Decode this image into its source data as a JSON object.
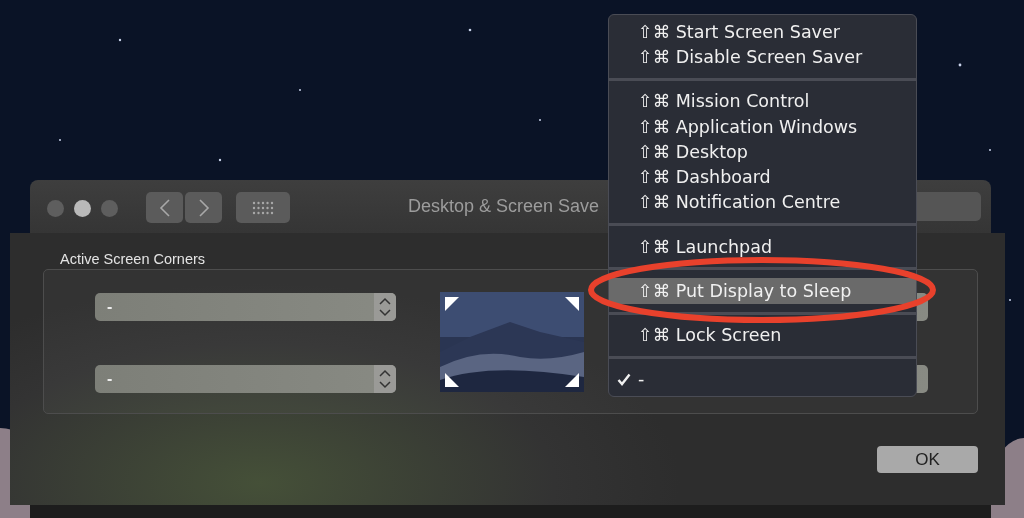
{
  "window": {
    "title": "Desktop & Screen Save"
  },
  "sheet": {
    "heading": "Active Screen Corners",
    "left_corners": [
      {
        "value": "-"
      },
      {
        "value": "-"
      }
    ],
    "ok_button": "OK"
  },
  "menu": {
    "sections": [
      [
        {
          "shortcut": "⇧⌘",
          "label": "Start Screen Saver",
          "selected": false,
          "checked": false
        },
        {
          "shortcut": "⇧⌘",
          "label": "Disable Screen Saver",
          "selected": false,
          "checked": false
        }
      ],
      [
        {
          "shortcut": "⇧⌘",
          "label": "Mission Control",
          "selected": false,
          "checked": false
        },
        {
          "shortcut": "⇧⌘",
          "label": "Application Windows",
          "selected": false,
          "checked": false
        },
        {
          "shortcut": "⇧⌘",
          "label": "Desktop",
          "selected": false,
          "checked": false
        },
        {
          "shortcut": "⇧⌘",
          "label": "Dashboard",
          "selected": false,
          "checked": false
        },
        {
          "shortcut": "⇧⌘",
          "label": "Notification Centre",
          "selected": false,
          "checked": false
        }
      ],
      [
        {
          "shortcut": "⇧⌘",
          "label": "Launchpad",
          "selected": false,
          "checked": false
        }
      ],
      [
        {
          "shortcut": "⇧⌘",
          "label": "Put Display to Sleep",
          "selected": true,
          "checked": false
        }
      ],
      [
        {
          "shortcut": "⇧⌘",
          "label": "Lock Screen",
          "selected": false,
          "checked": false
        }
      ],
      [
        {
          "label": "-",
          "selected": false,
          "checked": true
        }
      ]
    ]
  }
}
